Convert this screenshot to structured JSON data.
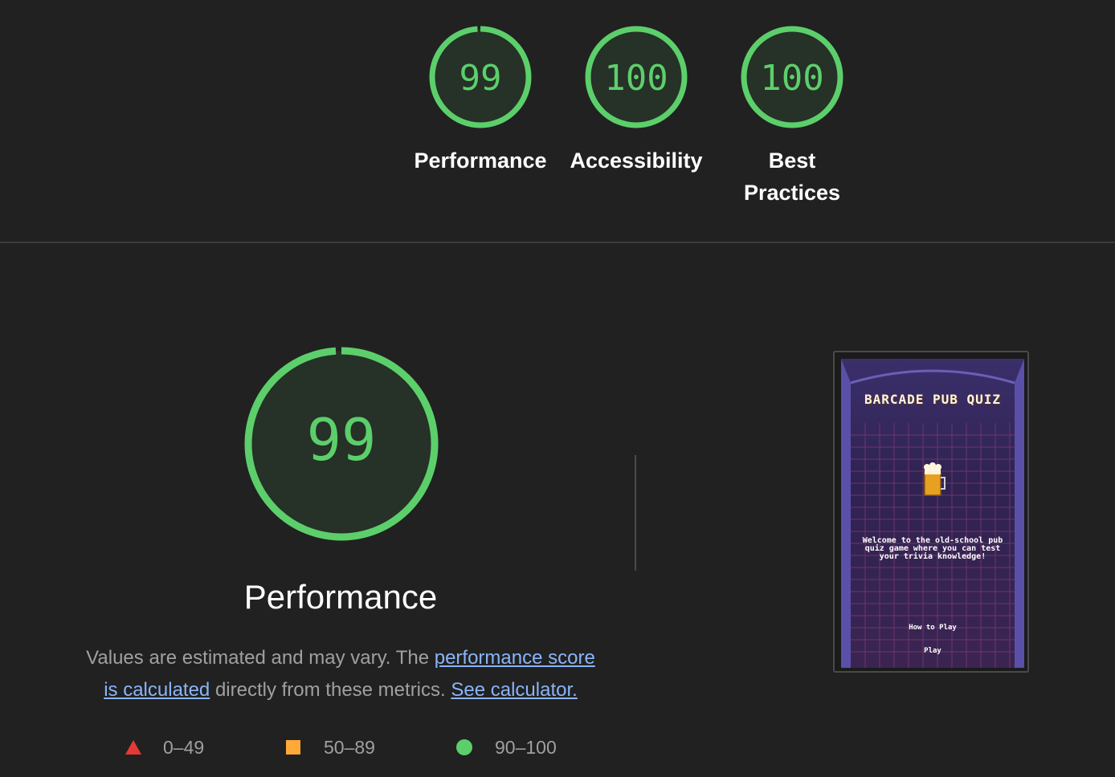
{
  "summary": {
    "categories": [
      {
        "label": "Performance",
        "score": "99",
        "score_value": 99,
        "color": "#5ccf6b"
      },
      {
        "label": "Accessibility",
        "score": "100",
        "score_value": 100,
        "color": "#5ccf6b"
      },
      {
        "label_line1": "Best",
        "label_line2": "Practices",
        "score": "100",
        "score_value": 100,
        "color": "#5ccf6b"
      }
    ]
  },
  "performance": {
    "score": "99",
    "score_value": 99,
    "title": "Performance",
    "desc_prefix": "Values are estimated and may vary. The ",
    "link_score": "performance score is calculated",
    "desc_middle": " directly from these metrics. ",
    "link_calculator": "See calculator."
  },
  "legend": [
    {
      "range": "0–49",
      "shape": "triangle-icon",
      "color": "#e53935"
    },
    {
      "range": "50–89",
      "shape": "square-icon",
      "color": "#ffa938"
    },
    {
      "range": "90–100",
      "shape": "circle-icon",
      "color": "#5ccf6b"
    }
  ],
  "screenshot": {
    "title": "Barcade Pub Quiz",
    "welcome": "Welcome to the old-school pub quiz game where you can test your trivia knowledge!",
    "how_to_play": "How to Play",
    "play": "Play"
  },
  "colors": {
    "background": "#212121",
    "pass_green": "#5ccf6b",
    "gauge_fill": "#263127",
    "link": "#8ab4f8"
  }
}
